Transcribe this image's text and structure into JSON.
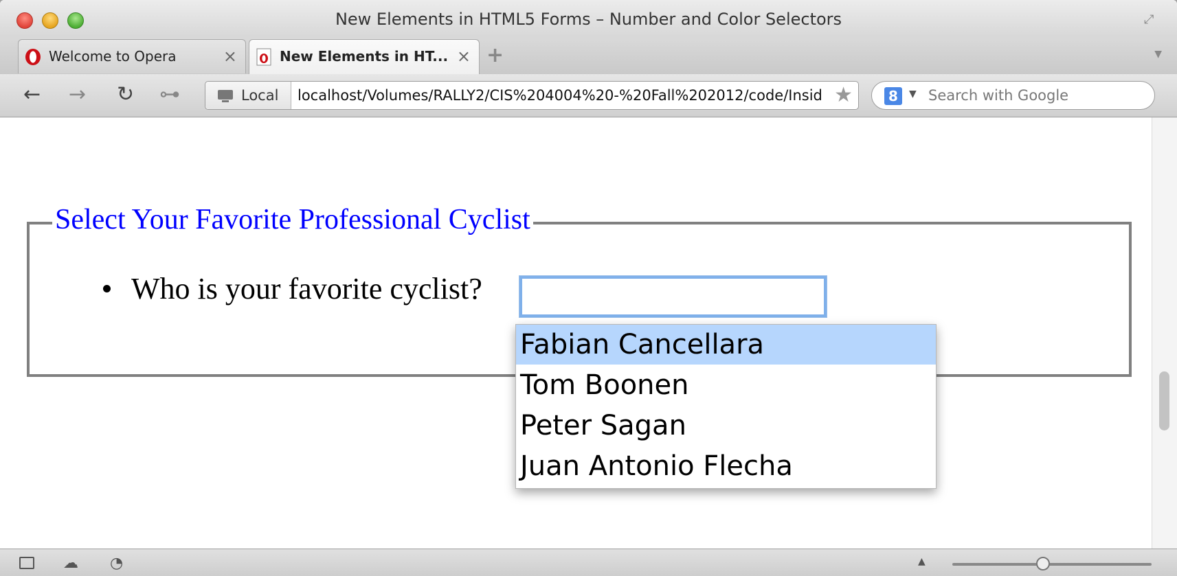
{
  "window": {
    "title": "New Elements in HTML5 Forms – Number and Color Selectors"
  },
  "tabs": [
    {
      "label": "Welcome to Opera",
      "icon": "opera-logo-icon",
      "active": false
    },
    {
      "label": "New Elements in HT...",
      "icon": "opera-page-icon",
      "active": true
    }
  ],
  "toolbar": {
    "back_icon": "←",
    "forward_icon": "→",
    "reload_icon": "↻",
    "key_icon": "⊶",
    "local_label": "Local",
    "url": "localhost/Volumes/RALLY2/CIS%204004%20-%20Fall%202012/code/Insid",
    "search_placeholder": "Search with Google",
    "search_engine_letter": "8"
  },
  "page": {
    "legend": "Select Your Favorite Professional Cyclist",
    "question": "Who is your favorite cyclist?",
    "input_value": "",
    "suggestions": [
      "Fabian Cancellara",
      "Tom Boonen",
      "Peter Sagan",
      "Juan Antonio Flecha"
    ],
    "selected_suggestion_index": 0
  },
  "colors": {
    "legend": "#0000ff",
    "selection_highlight": "#b6d6fd",
    "input_focus": "#7fb0ea",
    "fieldset_border": "#808080"
  }
}
